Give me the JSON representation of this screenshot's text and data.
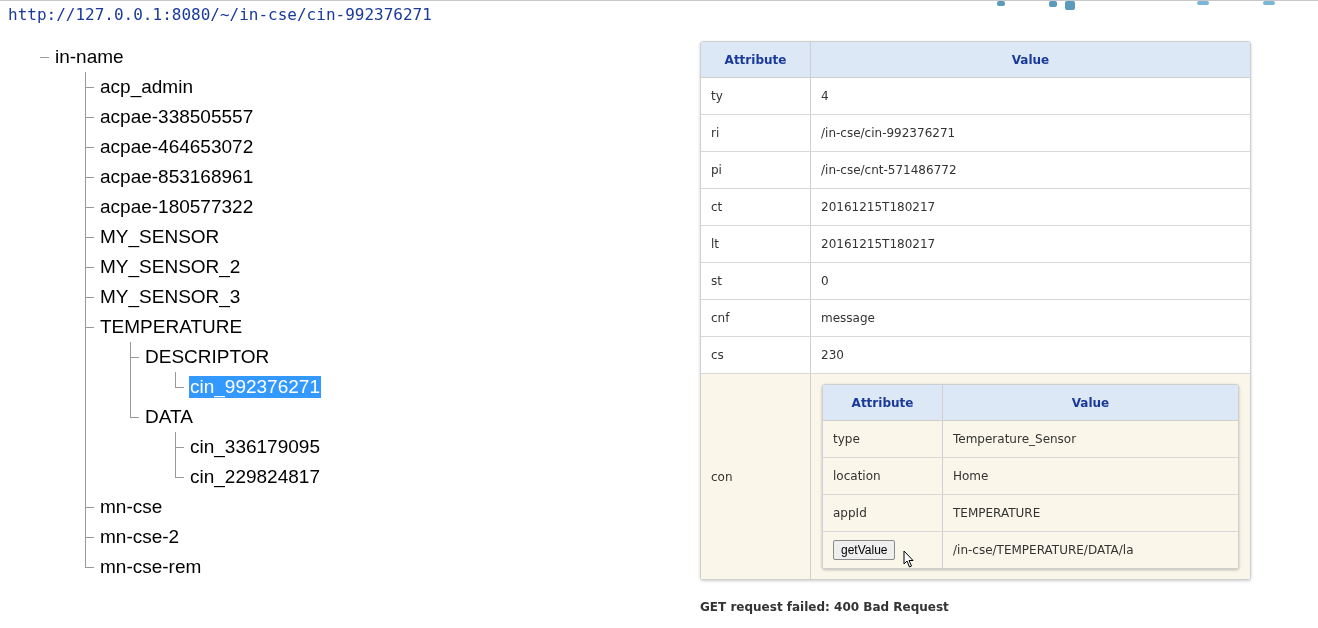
{
  "url": "http://127.0.0.1:8080/~/in-cse/cin-992376271",
  "tree": {
    "label": "in-name",
    "selected": false,
    "children": [
      {
        "label": "acp_admin",
        "selected": false
      },
      {
        "label": "acpae-338505557",
        "selected": false
      },
      {
        "label": "acpae-464653072",
        "selected": false
      },
      {
        "label": "acpae-853168961",
        "selected": false
      },
      {
        "label": "acpae-180577322",
        "selected": false
      },
      {
        "label": "MY_SENSOR",
        "selected": false
      },
      {
        "label": "MY_SENSOR_2",
        "selected": false
      },
      {
        "label": "MY_SENSOR_3",
        "selected": false
      },
      {
        "label": "TEMPERATURE",
        "selected": false,
        "children": [
          {
            "label": "DESCRIPTOR",
            "selected": false,
            "children": [
              {
                "label": "cin_992376271",
                "selected": true
              }
            ]
          },
          {
            "label": "DATA",
            "selected": false,
            "children": [
              {
                "label": "cin_336179095",
                "selected": false
              },
              {
                "label": "cin_229824817",
                "selected": false
              }
            ]
          }
        ]
      },
      {
        "label": "mn-cse",
        "selected": false
      },
      {
        "label": "mn-cse-2",
        "selected": false
      },
      {
        "label": "mn-cse-rem",
        "selected": false
      }
    ]
  },
  "attributes": {
    "columns": [
      "Attribute",
      "Value"
    ],
    "rows": [
      {
        "kind": "text",
        "name": "ty",
        "value": "4"
      },
      {
        "kind": "text",
        "name": "ri",
        "value": "/in-cse/cin-992376271"
      },
      {
        "kind": "text",
        "name": "pi",
        "value": "/in-cse/cnt-571486772"
      },
      {
        "kind": "text",
        "name": "ct",
        "value": "20161215T180217"
      },
      {
        "kind": "text",
        "name": "lt",
        "value": "20161215T180217"
      },
      {
        "kind": "text",
        "name": "st",
        "value": "0"
      },
      {
        "kind": "text",
        "name": "cnf",
        "value": "message"
      },
      {
        "kind": "text",
        "name": "cs",
        "value": "230"
      },
      {
        "kind": "table",
        "name": "con",
        "table": {
          "columns": [
            "Attribute",
            "Value"
          ],
          "rows": [
            {
              "kind": "text",
              "name": "type",
              "value": "Temperature_Sensor"
            },
            {
              "kind": "text",
              "name": "location",
              "value": "Home"
            },
            {
              "kind": "text",
              "name": "appId",
              "value": "TEMPERATURE"
            },
            {
              "kind": "button",
              "name": "getValue",
              "value": "/in-cse/TEMPERATURE/DATA/la"
            }
          ]
        }
      }
    ]
  },
  "status": "GET request failed: 400 Bad Request"
}
